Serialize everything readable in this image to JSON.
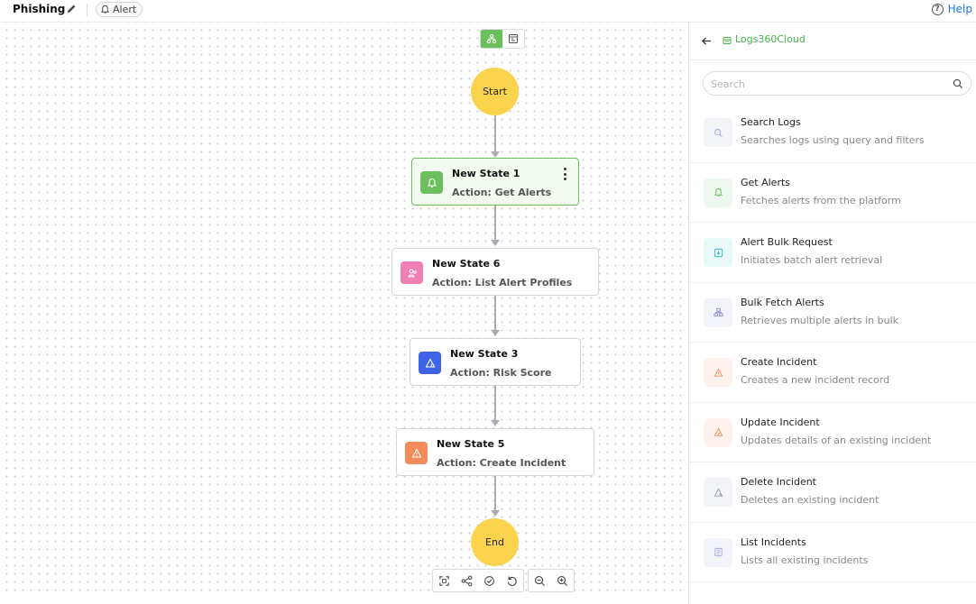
{
  "header": {
    "title": "Phishing",
    "tag_label": "Alert",
    "help_label": "Help"
  },
  "canvas": {
    "start_label": "Start",
    "end_label": "End",
    "states": [
      {
        "title": "New State 1",
        "action": "Action: Get Alerts",
        "icon": "bell-icon",
        "color": "#6cbf5d",
        "selected": true
      },
      {
        "title": "New State 6",
        "action": "Action: List Alert Profiles",
        "icon": "users-icon",
        "color": "#f07fb4",
        "selected": false
      },
      {
        "title": "New State 3",
        "action": "Action: Risk Score",
        "icon": "risk-triangle-icon",
        "color": "#3f63e6",
        "selected": false
      },
      {
        "title": "New State 5",
        "action": "Action: Create Incident",
        "icon": "warning-icon",
        "color": "#f48c5a",
        "selected": false
      }
    ],
    "toolbar_icons": [
      "fit-view-icon",
      "auto-layout-icon",
      "validate-icon",
      "reset-icon",
      "zoom-out-icon",
      "zoom-in-icon"
    ]
  },
  "panel": {
    "breadcrumb": "Logs360Cloud",
    "search_placeholder": "Search",
    "actions": [
      {
        "title": "Search Logs",
        "desc": "Searches logs using query and filters",
        "icon": "search-icon",
        "bg": "#f3f4f8",
        "color": "#a8a6e8"
      },
      {
        "title": "Get Alerts",
        "desc": "Fetches alerts from the platform",
        "icon": "bell-icon",
        "bg": "#eef8ee",
        "color": "#6cbf5d"
      },
      {
        "title": "Alert Bulk Request",
        "desc": "Initiates batch alert retrieval",
        "icon": "download-icon",
        "bg": "#e9f8f8",
        "color": "#3bb6c2"
      },
      {
        "title": "Bulk Fetch Alerts",
        "desc": "Retrieves multiple alerts in bulk",
        "icon": "hierarchy-icon",
        "bg": "#f3f3fa",
        "color": "#8f8cd8"
      },
      {
        "title": "Create Incident",
        "desc": "Creates a new incident record",
        "icon": "warning-icon",
        "bg": "#fdf3ee",
        "color": "#f48c5a"
      },
      {
        "title": "Update Incident",
        "desc": "Updates details of an existing incident",
        "icon": "warning-edit-icon",
        "bg": "#fdf3ee",
        "color": "#f48c5a"
      },
      {
        "title": "Delete Incident",
        "desc": "Deletes an existing incident",
        "icon": "warning-delete-icon",
        "bg": "#f3f4f8",
        "color": "#9a9cb5"
      },
      {
        "title": "List Incidents",
        "desc": "Lists all existing incidents",
        "icon": "list-icon",
        "bg": "#f3f3fa",
        "color": "#a8a6e8"
      }
    ]
  }
}
